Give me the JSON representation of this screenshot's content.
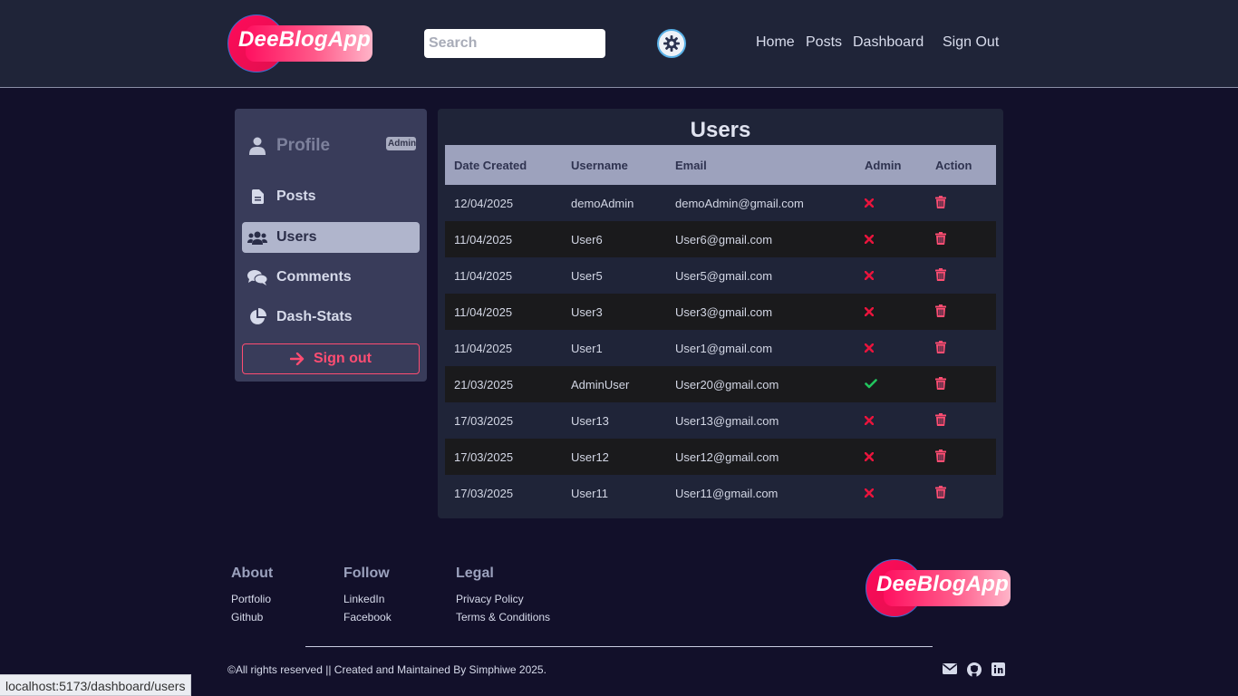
{
  "header": {
    "logo_text": "DeeBlogApp",
    "search_placeholder": "Search",
    "theme_icon": "sun-gear-icon",
    "nav": [
      "Home",
      "Posts",
      "Dashboard",
      "Sign Out"
    ]
  },
  "sidebar": {
    "profile_label": "Profile",
    "admin_badge": "Admin",
    "items": [
      {
        "label": "Posts",
        "icon": "document-icon"
      },
      {
        "label": "Users",
        "icon": "users-icon"
      },
      {
        "label": "Comments",
        "icon": "comments-icon"
      },
      {
        "label": "Dash-Stats",
        "icon": "pie-chart-icon"
      }
    ],
    "signout_label": "Sign out"
  },
  "users": {
    "title": "Users",
    "columns": [
      "Date Created",
      "Username",
      "Email",
      "Admin",
      "Action"
    ],
    "rows": [
      {
        "date": "12/04/2025",
        "username": "demoAdmin",
        "email": "demoAdmin@gmail.com",
        "admin": false
      },
      {
        "date": "11/04/2025",
        "username": "User6",
        "email": "User6@gmail.com",
        "admin": false
      },
      {
        "date": "11/04/2025",
        "username": "User5",
        "email": "User5@gmail.com",
        "admin": false
      },
      {
        "date": "11/04/2025",
        "username": "User3",
        "email": "User3@gmail.com",
        "admin": false
      },
      {
        "date": "11/04/2025",
        "username": "User1",
        "email": "User1@gmail.com",
        "admin": false
      },
      {
        "date": "21/03/2025",
        "username": "AdminUser",
        "email": "User20@gmail.com",
        "admin": true
      },
      {
        "date": "17/03/2025",
        "username": "User13",
        "email": "User13@gmail.com",
        "admin": false
      },
      {
        "date": "17/03/2025",
        "username": "User12",
        "email": "User12@gmail.com",
        "admin": false
      },
      {
        "date": "17/03/2025",
        "username": "User11",
        "email": "User11@gmail.com",
        "admin": false
      }
    ]
  },
  "footer": {
    "about": {
      "heading": "About",
      "links": [
        "Portfolio",
        "Github"
      ]
    },
    "follow": {
      "heading": "Follow",
      "links": [
        "LinkedIn",
        "Facebook"
      ]
    },
    "legal": {
      "heading": "Legal",
      "links": [
        "Privacy Policy",
        "Terms & Conditions"
      ]
    },
    "logo_text": "DeeBlogApp",
    "copyright": "©All rights reserved || Created and Maintained By Simphiwe 2025.",
    "socials": [
      "email-icon",
      "github-icon",
      "linkedin-icon"
    ]
  },
  "status_bar": {
    "url": "localhost:5173/dashboard/users"
  },
  "colors": {
    "accent": "#ff4d72",
    "admin_no": "#e8143c",
    "admin_yes": "#22c55e",
    "header_bg": "#1f2438",
    "page_bg": "#12102a"
  }
}
